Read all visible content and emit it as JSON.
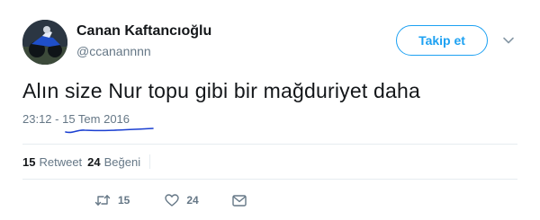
{
  "user": {
    "name": "Canan Kaftancıoğlu",
    "handle": "@ccanannnn"
  },
  "follow_button": {
    "label": "Takip et"
  },
  "tweet": {
    "text": "Alın size Nur topu gibi bir mağduriyet daha",
    "timestamp": "23:12 - 15 Tem 2016"
  },
  "stats": {
    "retweets_count": "15",
    "retweets_label": "Retweet",
    "likes_count": "24",
    "likes_label": "Beğeni"
  },
  "actions": {
    "reply_icon": "reply-icon",
    "retweet_icon": "retweet-icon",
    "retweet_count": "15",
    "like_icon": "heart-icon",
    "like_count": "24",
    "dm_icon": "envelope-icon"
  },
  "colors": {
    "accent": "#1da1f2",
    "text": "#14171a",
    "secondary": "#657786",
    "divider": "#e6ecf0",
    "ink_underline": "#1a3fd1"
  }
}
